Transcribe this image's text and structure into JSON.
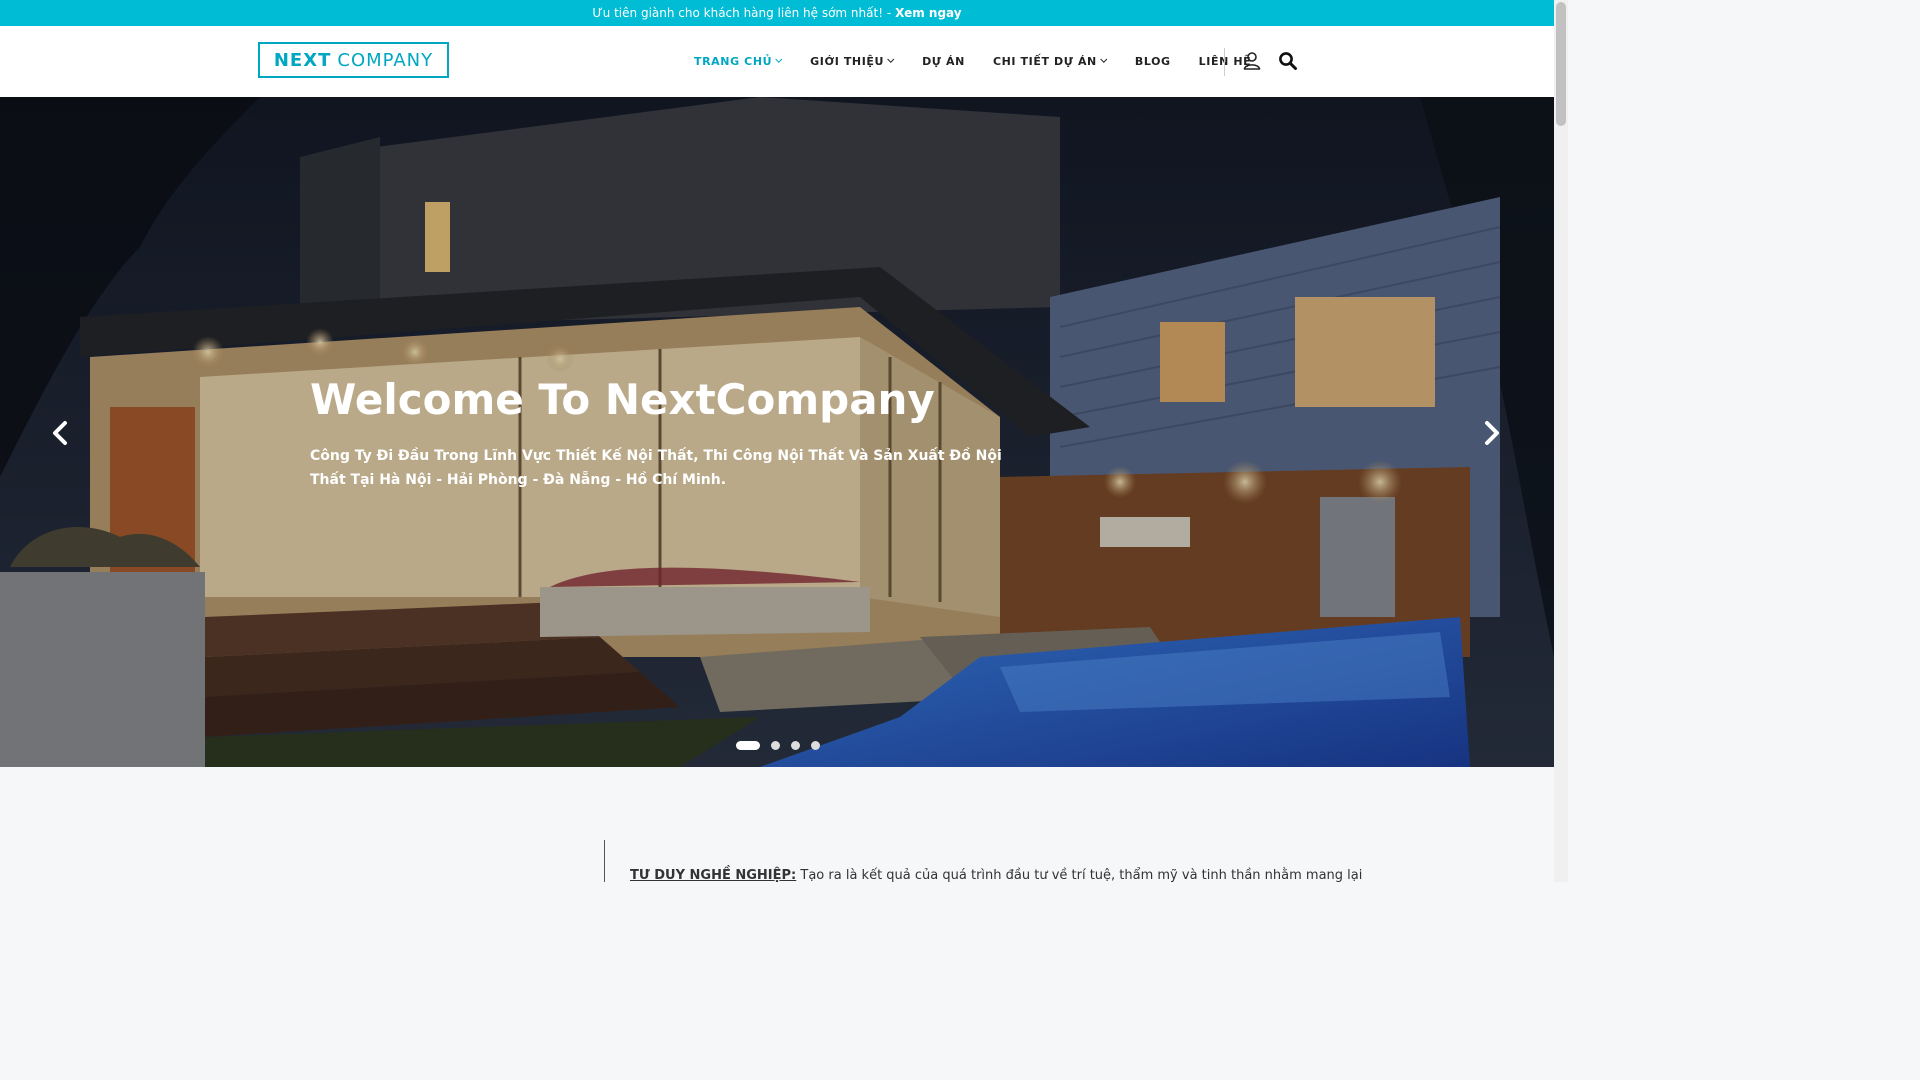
{
  "topbar": {
    "message": "Ưu tiên giành cho khách hàng liên hệ sớm nhất! -",
    "cta": "Xem ngay"
  },
  "logo": {
    "bold": "NEXT",
    "light": "COMPANY"
  },
  "nav": {
    "items": [
      {
        "label": "TRANG CHỦ",
        "dropdown": true,
        "active": true
      },
      {
        "label": "GIỚI THIỆU",
        "dropdown": true
      },
      {
        "label": "DỰ ÁN",
        "dropdown": false
      },
      {
        "label": "CHI TIẾT DỰ ÁN",
        "dropdown": true
      },
      {
        "label": "BLOG",
        "dropdown": false
      },
      {
        "label": "LIÊN HỆ",
        "dropdown": false
      }
    ],
    "user_icon": "user-icon",
    "search_icon": "search-icon"
  },
  "hero": {
    "title": "Welcome To NextCompany",
    "subtitle": "Công Ty Đi Đầu Trong Lĩnh Vực Thiết Kế Nội Thất, Thi Công Nội Thất Và Sản Xuất Đồ Nội Thất Tại Hà Nội - Hải Phòng - Đà Nẵng - Hồ Chí Minh.",
    "slides_total": 4,
    "active_slide": 1
  },
  "content": {
    "lead_label": "TƯ DUY NGHỀ NGHIỆP:",
    "lead_text": " Tạo ra là kết quả của quá trình đầu tư về trí tuệ, thẩm mỹ và tinh thần nhằm mang lại"
  },
  "colors": {
    "accent": "#00bcd4",
    "accent_dark": "#00a7c2"
  }
}
